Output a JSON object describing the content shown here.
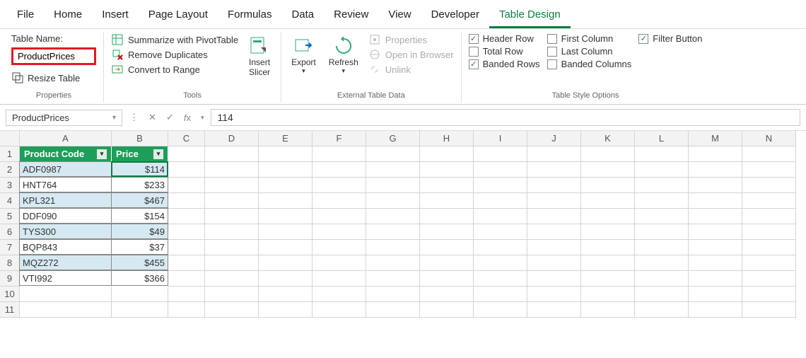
{
  "tabs": [
    "File",
    "Home",
    "Insert",
    "Page Layout",
    "Formulas",
    "Data",
    "Review",
    "View",
    "Developer",
    "Table Design"
  ],
  "active_tab": "Table Design",
  "ribbon": {
    "properties": {
      "label": "Properties",
      "table_name_label": "Table Name:",
      "table_name_value": "ProductPrices",
      "resize": "Resize Table"
    },
    "tools": {
      "label": "Tools",
      "summarize": "Summarize with PivotTable",
      "remove_dup": "Remove Duplicates",
      "convert": "Convert to Range",
      "slicer_top": "Insert",
      "slicer_bot": "Slicer"
    },
    "external": {
      "label": "External Table Data",
      "export": "Export",
      "refresh": "Refresh",
      "props": "Properties",
      "open": "Open in Browser",
      "unlink": "Unlink"
    },
    "options": {
      "label": "Table Style Options",
      "header_row": "Header Row",
      "total_row": "Total Row",
      "banded_rows": "Banded Rows",
      "first_col": "First Column",
      "last_col": "Last Column",
      "banded_cols": "Banded Columns",
      "filter": "Filter Button"
    }
  },
  "namebox": "ProductPrices",
  "formula": "114",
  "columns": [
    "A",
    "B",
    "C",
    "D",
    "E",
    "F",
    "G",
    "H",
    "I",
    "J",
    "K",
    "L",
    "M",
    "N"
  ],
  "chart_data": {
    "type": "table",
    "headers": [
      "Product Code",
      "Price"
    ],
    "rows": [
      {
        "code": "ADF0987",
        "price": "$114"
      },
      {
        "code": "HNT764",
        "price": "$233"
      },
      {
        "code": "KPL321",
        "price": "$467"
      },
      {
        "code": "DDF090",
        "price": "$154"
      },
      {
        "code": "TYS300",
        "price": "$49"
      },
      {
        "code": "BQP843",
        "price": "$37"
      },
      {
        "code": "MQZ272",
        "price": "$455"
      },
      {
        "code": "VTI992",
        "price": "$366"
      }
    ]
  }
}
